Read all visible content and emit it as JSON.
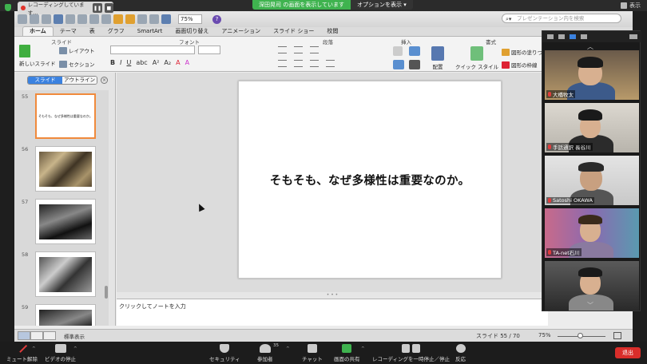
{
  "top": {
    "recording_label": "レコーディングしています...",
    "share_banner": "深田晃司 の画面を表示しています",
    "options_label": "オプションを表示",
    "display_label": "表示"
  },
  "toolbar": {
    "zoom": "75%",
    "search_placeholder": "プレゼンテーション内を検索"
  },
  "ribbon": {
    "tabs": [
      "ホーム",
      "テーマ",
      "表",
      "グラフ",
      "SmartArt",
      "画面切り替え",
      "アニメーション",
      "スライド ショー",
      "校閲"
    ],
    "groups": {
      "slide": "スライド",
      "font": "フォント",
      "paragraph": "段落",
      "insert": "挿入",
      "format": "書式"
    },
    "buttons": {
      "new_slide": "新しいスライド",
      "layout": "レイアウト",
      "section": "セクション",
      "arrange": "配置",
      "quick_style": "クイック スタイル",
      "shape_fill": "図形の塗りつ",
      "shape_outline": "図形の枠線"
    }
  },
  "left_panel": {
    "tab_slides": "スライド",
    "tab_outline": "アウトライン",
    "thumbnails": [
      {
        "num": "55",
        "title": "そもそも、なぜ多様性は重要なのか。"
      },
      {
        "num": "56",
        "title": ""
      },
      {
        "num": "57",
        "title": ""
      },
      {
        "num": "58",
        "title": ""
      },
      {
        "num": "59",
        "title": ""
      }
    ]
  },
  "slide": {
    "title": "そもそも、なぜ多様性は重要なのか。"
  },
  "notes": {
    "placeholder": "クリックしてノートを入力"
  },
  "status": {
    "view_label": "標準表示",
    "slide_count": "スライド 55 / 70",
    "zoom": "75%"
  },
  "participants": [
    {
      "name": "大橋牧太"
    },
    {
      "name": "手話通訳 長谷川"
    },
    {
      "name": "Satoshi OKAWA"
    },
    {
      "name": "TA-net石川"
    },
    {
      "name": ""
    }
  ],
  "bottom_bar": {
    "unmute": "ミュート解除",
    "stop_video": "ビデオの停止",
    "security": "セキュリティ",
    "participants": "参加者",
    "participants_count": "35",
    "chat": "チャット",
    "share": "画面の共有",
    "recording": "レコーディングを一時停止／停止",
    "reactions": "反応",
    "end": "退出"
  },
  "colors": {
    "accent_blue": "#3b82e0",
    "share_green": "#3fb34f",
    "end_red": "#d92d2a",
    "selected_thumb": "#f08a3c"
  }
}
